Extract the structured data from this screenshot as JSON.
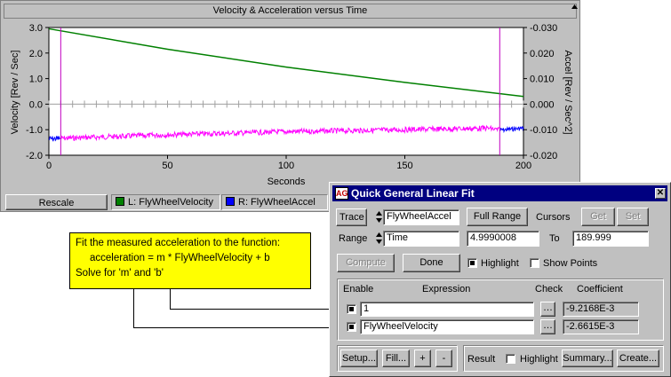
{
  "chart": {
    "title": "Velocity & Acceleration versus Time",
    "ylabel_left": "Velocity [Rev / Sec]",
    "ylabel_right": "Accel [Rev / Sec^2]",
    "xlabel": "Seconds",
    "left_ticks": [
      "3.0",
      "2.0",
      "1.0",
      "0.0",
      "-1.0",
      "-2.0"
    ],
    "right_ticks": [
      "-0.030",
      "0.020",
      "0.010",
      "0.000",
      "-0.010",
      "-0.020"
    ],
    "x_ticks": [
      "0",
      "50",
      "100",
      "150",
      "200"
    ],
    "colors": {
      "velocity": "#008000",
      "accel": "#ff00ff",
      "accel_outside": "#0000ff",
      "cursor": "#c000c0"
    }
  },
  "chart_data": {
    "type": "line",
    "title": "Velocity & Acceleration versus Time",
    "xlabel": "Seconds",
    "ylabel": "Velocity [Rev / Sec]",
    "y2label": "Accel [Rev / Sec^2]",
    "xlim": [
      0,
      200
    ],
    "ylim": [
      -2.0,
      3.0
    ],
    "y2lim": [
      -0.02,
      0.03
    ],
    "cursors_x": [
      4.9990008,
      189.999
    ],
    "series": [
      {
        "name": "FlyWheelVelocity",
        "axis": "left",
        "x": [
          0,
          50,
          100,
          150,
          200
        ],
        "y": [
          2.95,
          2.15,
          1.45,
          0.85,
          0.3
        ]
      },
      {
        "name": "FlyWheelAccel",
        "axis": "right",
        "x": [
          0,
          5,
          50,
          100,
          150,
          185,
          190,
          200
        ],
        "y": [
          -0.0137,
          -0.0134,
          -0.012,
          -0.0108,
          -0.01,
          -0.0094,
          -0.0102,
          -0.0094
        ]
      }
    ]
  },
  "status": {
    "rescale": "Rescale",
    "left_trace": "L:  FlyWheelVelocity",
    "right_trace": "R:  FlyWheelAccel"
  },
  "annotation": {
    "line1": "Fit the measured acceleration to the function:",
    "line2": "acceleration = m * FlyWheelVelocity + b",
    "line3": "Solve for 'm' and 'b'"
  },
  "dialog": {
    "title": "Quick General Linear Fit",
    "icon_text": "AG",
    "close": "✕",
    "trace_label": "Trace",
    "trace_value": "FlyWheelAccel",
    "full_range": "Full Range",
    "cursors_label": "Cursors",
    "get": "Get",
    "set": "Set",
    "range_label": "Range",
    "range_value": "Time",
    "range_from": "4.9990008",
    "to_label": "To",
    "range_to": "189.999",
    "compute": "Compute",
    "done": "Done",
    "highlight": "Highlight",
    "show_points": "Show Points",
    "enable_header": "Enable",
    "expression_header": "Expression",
    "check_header": "Check",
    "coefficient_header": "Coefficient",
    "rows": [
      {
        "expression": "1",
        "check": "…",
        "coefficient": "-9.2168E-3"
      },
      {
        "expression": "FlyWheelVelocity",
        "check": "…",
        "coefficient": "-2.6615E-3"
      }
    ],
    "setup": "Setup...",
    "fill": "Fill...",
    "plus": "+",
    "minus": "-",
    "result_label": "Result",
    "result_highlight": "Highlight",
    "summary": "Summary...",
    "create": "Create..."
  }
}
